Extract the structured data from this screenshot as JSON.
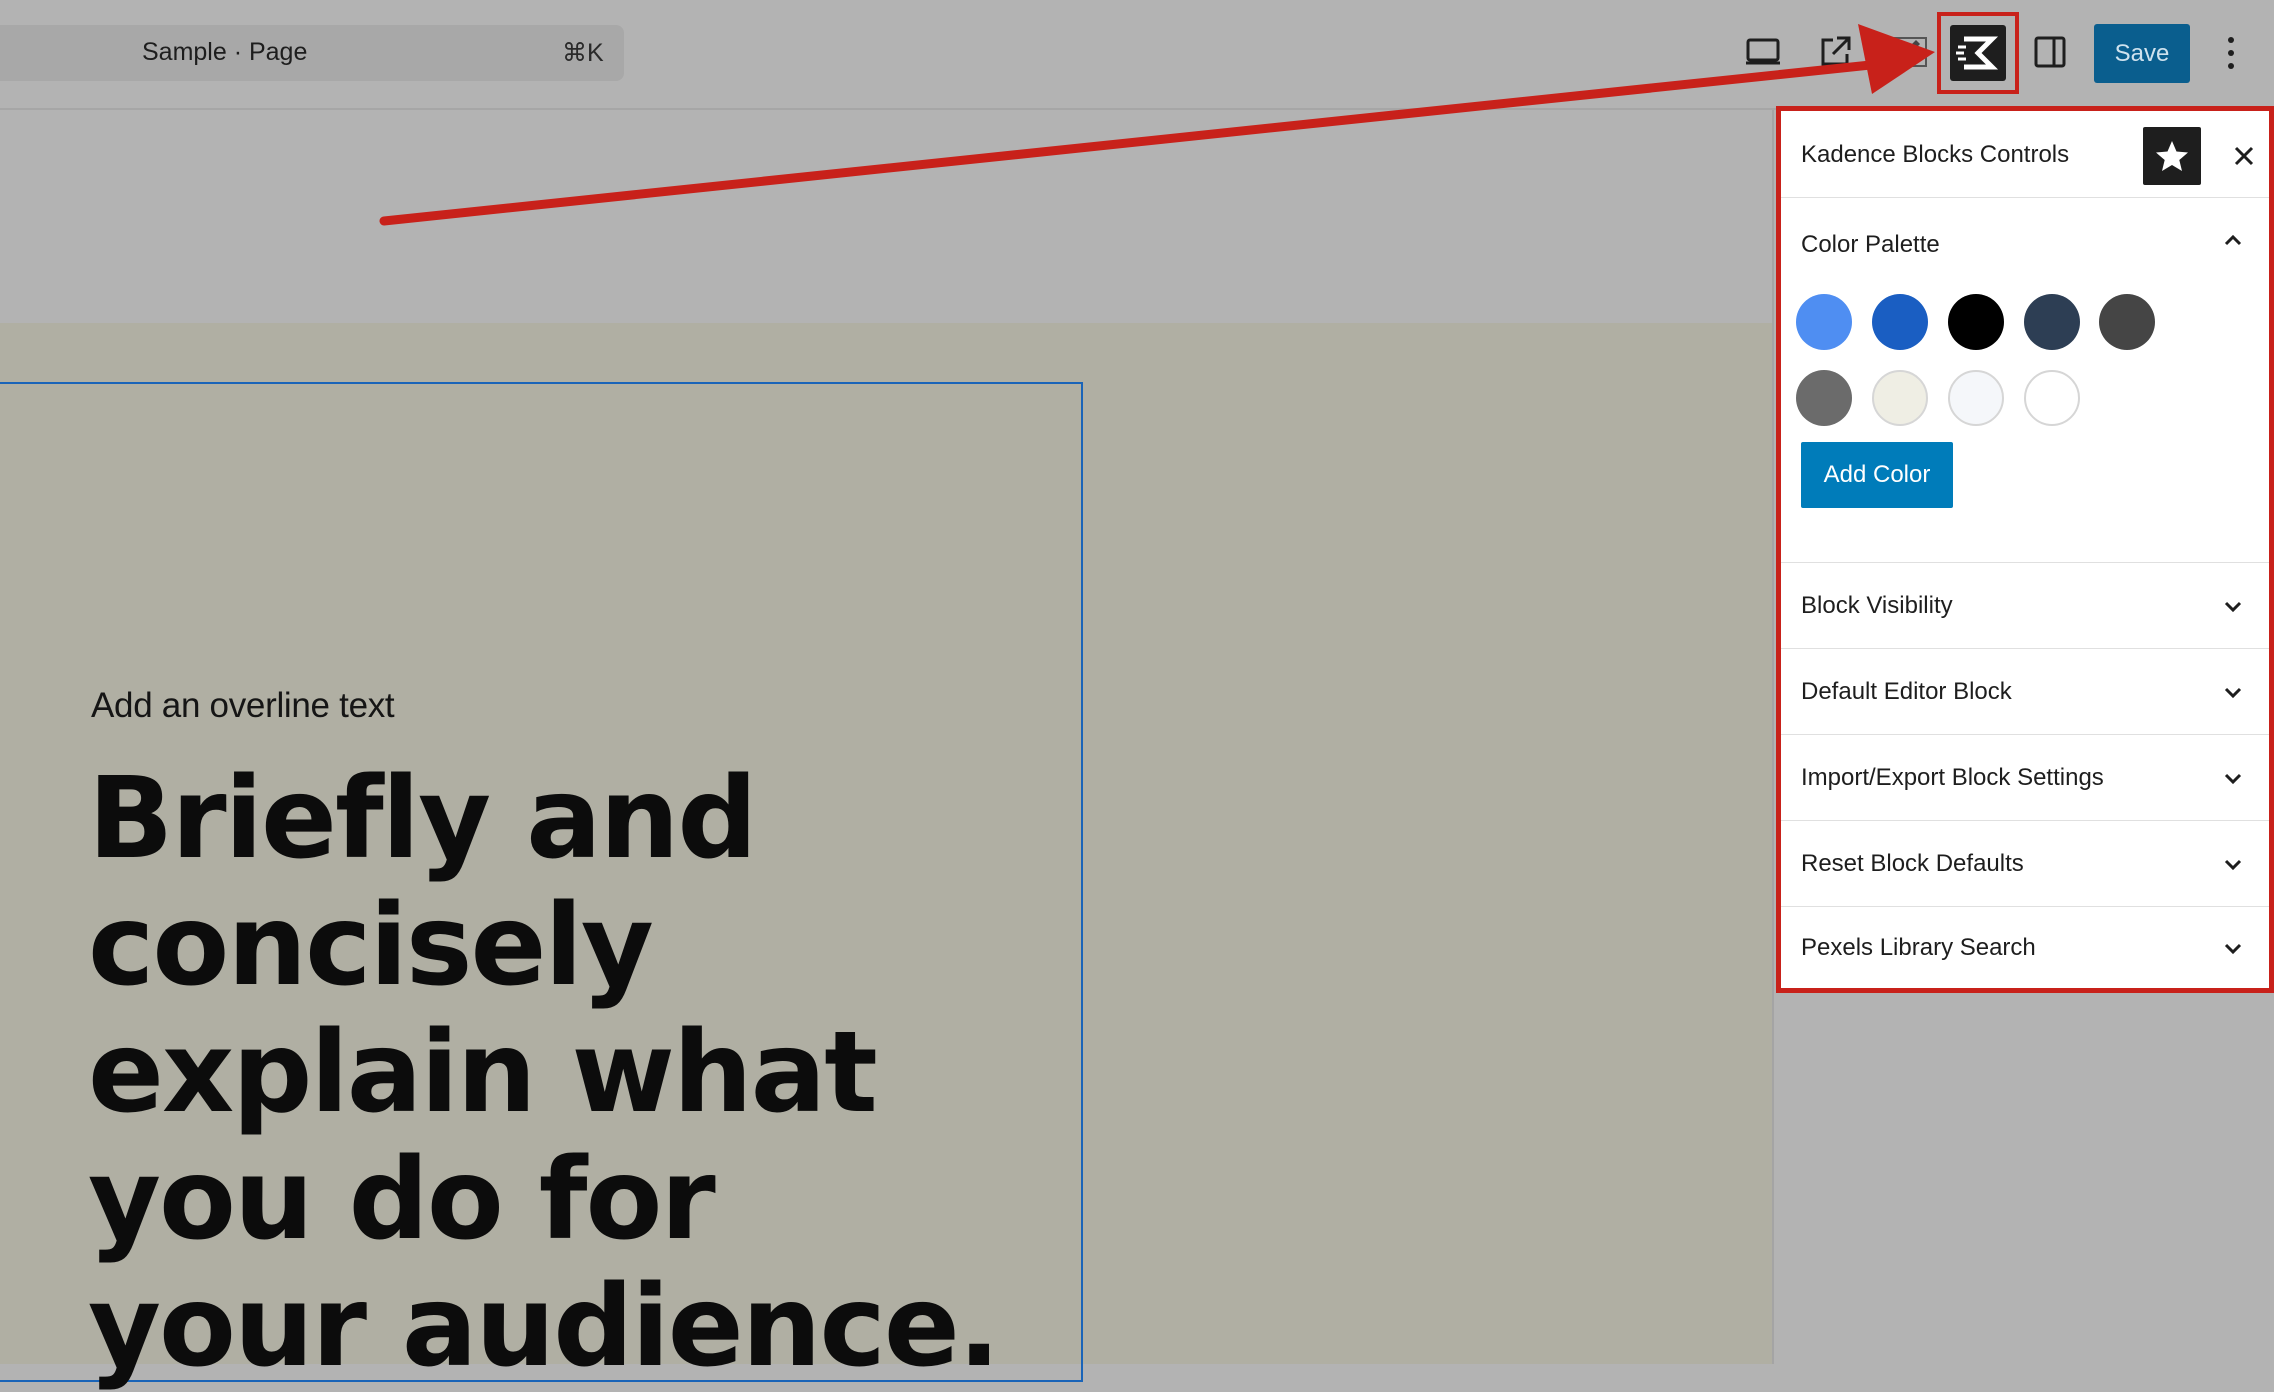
{
  "topbar": {
    "command": {
      "title": "Sample · Page",
      "shortcut": "⌘K"
    },
    "icons": [
      "desktop-preview-icon",
      "external-link-icon",
      "edit-pencil-icon",
      "kadence-icon",
      "sidebar-toggle-icon",
      "more-vertical-icon"
    ],
    "save_label": "Save"
  },
  "canvas": {
    "overline": "Add an overline text",
    "headline_lines": [
      "Briefly and",
      "concisely",
      "explain what",
      "you do for",
      "your audience."
    ]
  },
  "panel": {
    "title": "Kadence Blocks Controls",
    "color_palette": {
      "title": "Color Palette",
      "expanded": true,
      "swatches": [
        "#4f8ef2",
        "#1a5ec2",
        "#000000",
        "#2d3e54",
        "#454545",
        "#6b6b6b",
        "#efeee4",
        "#f5f7fa",
        "#ffffff"
      ],
      "add_label": "Add Color"
    },
    "sections": [
      {
        "title": "Block Visibility"
      },
      {
        "title": "Default Editor Block"
      },
      {
        "title": "Import/Export Block Settings"
      },
      {
        "title": "Reset Block Defaults"
      },
      {
        "title": "Pexels Library Search"
      }
    ]
  },
  "colors": {
    "highlight": "#c8211a",
    "save_button": "#0a5e8e",
    "primary": "#007cba",
    "block_outline": "#1a64b8"
  }
}
